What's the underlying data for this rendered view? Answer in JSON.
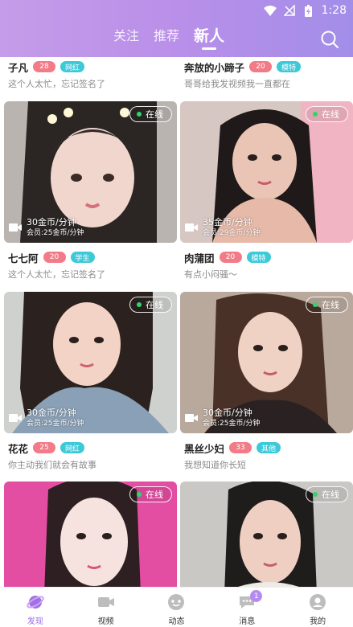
{
  "status_bar": {
    "time": "1:28",
    "battery_icon": "battery-charging-icon",
    "wifi_icon": "wifi-icon",
    "signal_icon": "no-signal-icon"
  },
  "header": {
    "tabs": [
      {
        "label": "关注"
      },
      {
        "label": "推荐"
      },
      {
        "label": "新人",
        "active": true
      }
    ],
    "search_icon": "search-icon",
    "accent": "#b98fe9"
  },
  "top_row": [
    {
      "name": "子凡",
      "age": "28",
      "tag": "网红",
      "signature": "这个人太忙，忘记签名了"
    },
    {
      "name": "奔放的小蹄子",
      "age": "20",
      "tag": "模特",
      "signature": "哥哥给我发视频我一直都在"
    }
  ],
  "cards": [
    {
      "online": "在线",
      "price": "30金币/分钟",
      "member_price": "会员:25金币/分钟",
      "name": "七七阿",
      "age": "20",
      "tag": "学生",
      "signature": "这个人太忙，忘记签名了"
    },
    {
      "online": "在线",
      "price": "35金币/分钟",
      "member_price": "会员:29金币/分钟",
      "name": "肉蒲团",
      "age": "20",
      "tag": "模特",
      "signature": "有点小闷骚～"
    },
    {
      "online": "在线",
      "price": "30金币/分钟",
      "member_price": "会员:25金币/分钟",
      "name": "花花",
      "age": "25",
      "tag": "网红",
      "signature": "你主动我们就会有故事"
    },
    {
      "online": "在线",
      "price": "30金币/分钟",
      "member_price": "会员:25金币/分钟",
      "name": "黑丝少妇",
      "age": "33",
      "tag": "其他",
      "signature": "我想知道你长短"
    },
    {
      "online": "在线"
    },
    {
      "online": "在线"
    }
  ],
  "bottom_nav": [
    {
      "label": "发现",
      "icon": "planet-icon",
      "active": true
    },
    {
      "label": "视频",
      "icon": "video-camera-icon"
    },
    {
      "label": "动态",
      "icon": "moments-icon"
    },
    {
      "label": "消息",
      "icon": "message-icon",
      "badge": "1"
    },
    {
      "label": "我的",
      "icon": "profile-icon"
    }
  ],
  "colors": {
    "age_badge": "#f37b88",
    "tag_badge": "#3cc9d8",
    "online_dot": "#33d36b",
    "active_nav": "#9a6ce3"
  }
}
